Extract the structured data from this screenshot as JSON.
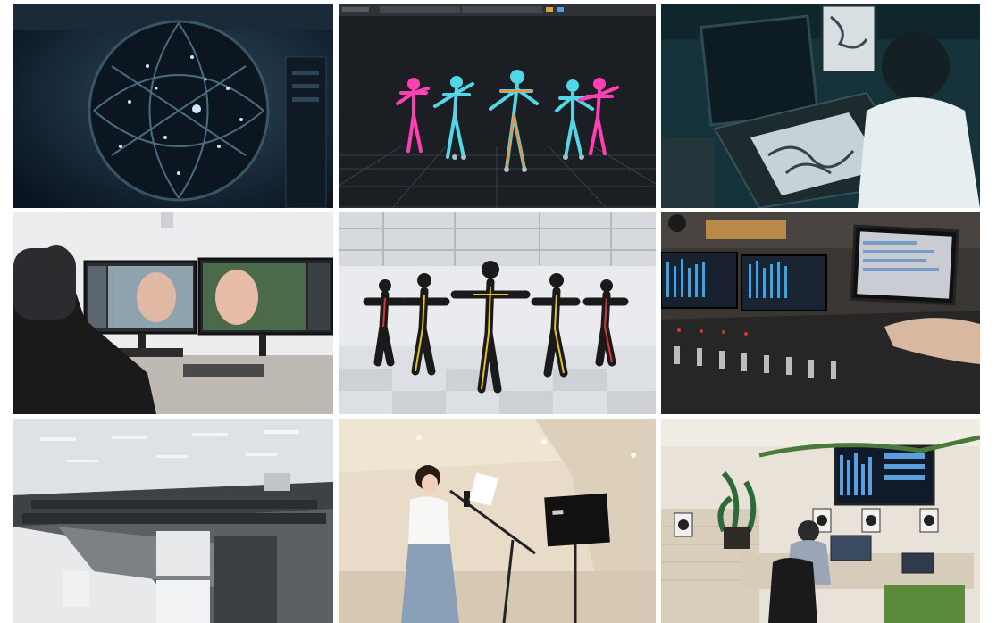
{
  "collage": {
    "tiles": [
      {
        "subject": "light-stage-scanner"
      },
      {
        "subject": "motion-capture-skeletons"
      },
      {
        "subject": "artist-drawing-tablet"
      },
      {
        "subject": "facial-compositing-workstation"
      },
      {
        "subject": "mocap-dancers-studio"
      },
      {
        "subject": "audio-mixing-console"
      },
      {
        "subject": "open-office-floor"
      },
      {
        "subject": "voice-recording-booth"
      },
      {
        "subject": "sound-studio-control-room"
      }
    ]
  },
  "colors": {
    "page_bg": "#ffffff",
    "teal_dark": "#16323a",
    "teal_mid": "#2b5a63",
    "mocap_pink": "#ff3fb4",
    "mocap_cyan": "#52d6e8",
    "mocap_orange": "#ff8a2a",
    "suit_black": "#1a1a1a",
    "suit_yellow": "#e6c21c"
  }
}
